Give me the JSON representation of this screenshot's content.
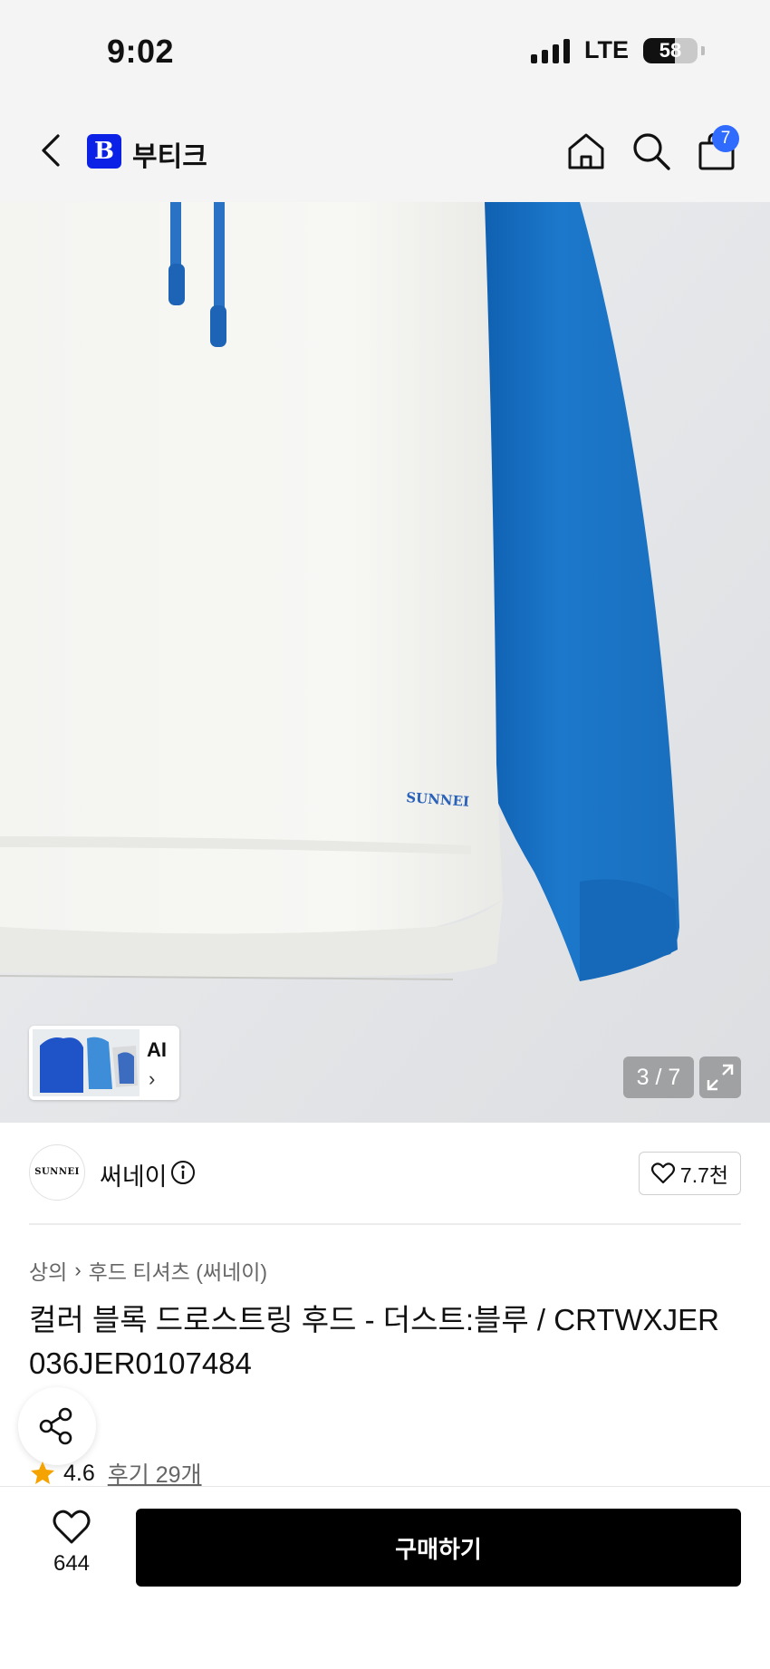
{
  "status_bar": {
    "time": "9:02",
    "network": "LTE",
    "battery": "58",
    "battery_level": 0.58
  },
  "nav": {
    "brand_logo_letter": "B",
    "brand_name": "부티크",
    "cart_count": "7",
    "icons": [
      "back-icon",
      "home-icon",
      "search-icon",
      "shopping-bag-icon"
    ]
  },
  "gallery": {
    "ai_label": "AI",
    "ai_chevron": "›",
    "counter": "3 / 7",
    "logo_embroidery": "SUNNEI",
    "garment_colors": {
      "body": "#f5f5f2",
      "sleeve": "#1a74c6",
      "drawstring": "#2a72c4"
    }
  },
  "brand": {
    "avatar_text": "SUNNEI",
    "name": "써네이",
    "like_count": "7.7천"
  },
  "product": {
    "breadcrumb": [
      "상의",
      "후드 티셔츠 (써네이)"
    ],
    "breadcrumb_separator": "›",
    "title": "컬러 블록 드로스트링 후드 - 더스트:블루 / CRTWXJER 036JER0107484",
    "rating": "4.6",
    "review_link": "후기 29개"
  },
  "bottom_bar": {
    "wish_count": "644",
    "buy_label": "구매하기"
  },
  "colors": {
    "brand_blue": "#0b21e6",
    "badge_blue": "#2f6bff",
    "star": "#f5a300",
    "buy_bg": "#000000"
  }
}
